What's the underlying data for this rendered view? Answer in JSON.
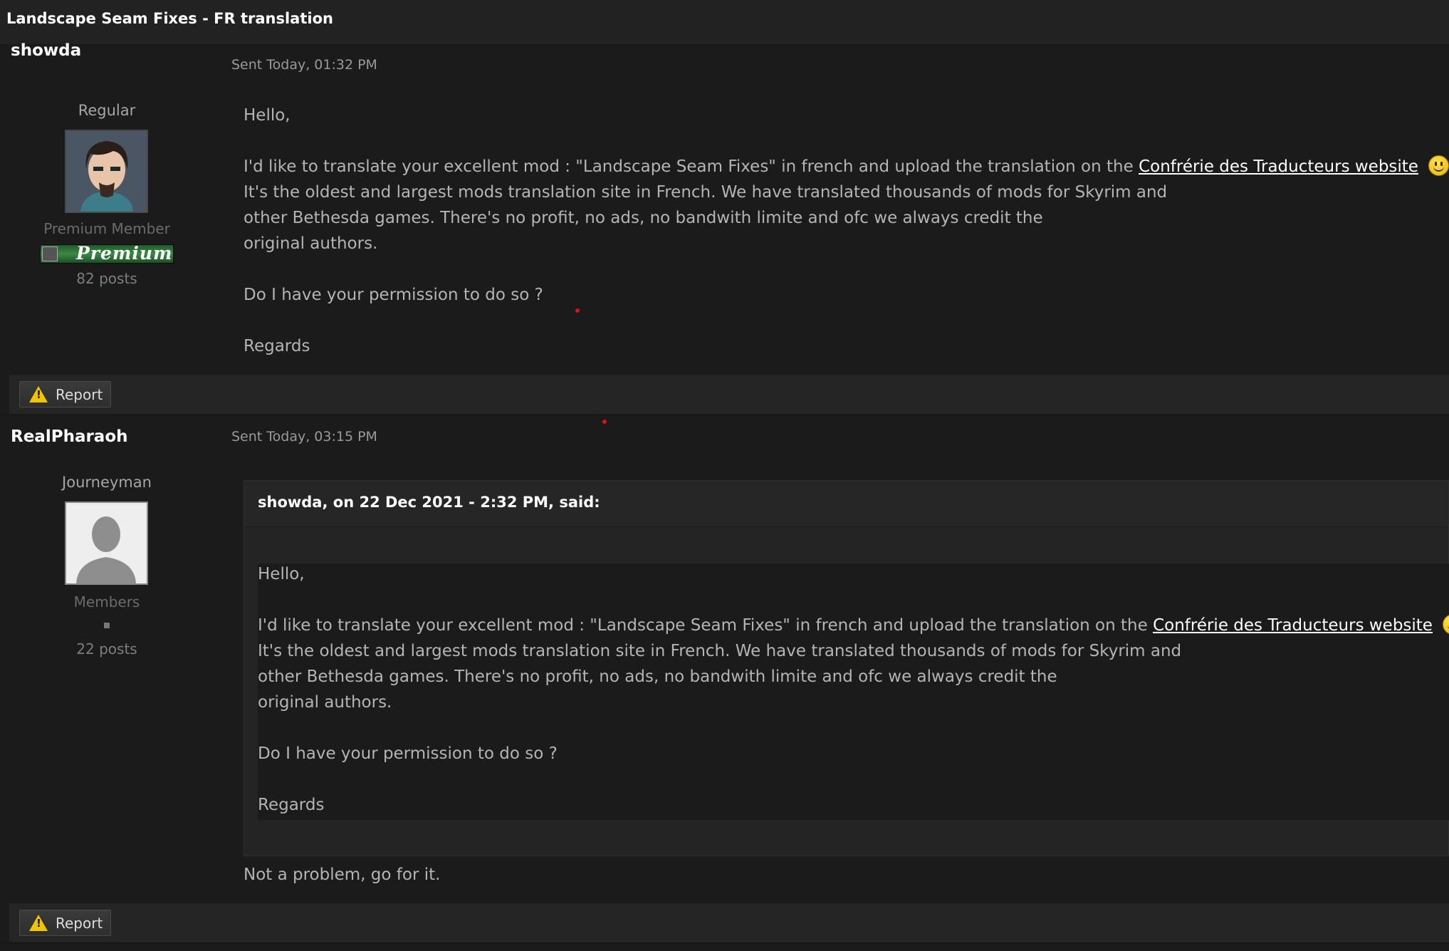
{
  "window": {
    "title": "Landscape Seam Fixes - FR translation"
  },
  "posts": [
    {
      "username": "showda",
      "sent": "Sent Today, 01:32 PM",
      "rank": "Regular",
      "group": "Premium Member",
      "badge": "Premium",
      "posts_count": "82 posts",
      "body": {
        "greeting": "Hello,",
        "line1_prefix": "I'd like to translate your excellent mod : \"Landscape Seam Fixes\" in french and upload the translation on the ",
        "link": "Confrérie des Traducteurs website",
        "line2": "It's the oldest and largest mods translation site in French. We have translated thousands of mods for Skyrim and",
        "line3": "other Bethesda games. There's no profit, no ads, no bandwith limite and ofc we always credit the",
        "line4": "original authors.",
        "question": "Do I have your permission to do so ?",
        "closing": "Regards"
      },
      "report_label": "Report"
    },
    {
      "username": "RealPharaoh",
      "sent": "Sent Today, 03:15 PM",
      "rank": "Journeyman",
      "group": "Members",
      "posts_count": "22 posts",
      "quote": {
        "author": "showda, on 22 Dec 2021 - 2:32 PM, said:",
        "greeting": "Hello,",
        "line1_prefix": "I'd like to translate your excellent mod : \"Landscape Seam Fixes\" in french and upload the translation on the ",
        "link": "Confrérie des Traducteurs website",
        "line2": "It's the oldest and largest mods translation site in French. We have translated thousands of mods for Skyrim and",
        "line3": "other Bethesda games. There's no profit, no ads, no bandwith limite and ofc we always credit the",
        "line4": "original authors.",
        "question": "Do I have your permission to do so ?",
        "closing": "Regards"
      },
      "reply": "Not a problem, go for it.",
      "report_label": "Report"
    }
  ],
  "icons": {
    "smiley": "smiley-icon",
    "warning": "warning-icon",
    "avatar_default": "default-avatar-icon"
  },
  "colors": {
    "background": "#1b1b1b",
    "link": "#ffffff",
    "premium_badge": "#3a8a44",
    "warning": "#f2c300"
  }
}
